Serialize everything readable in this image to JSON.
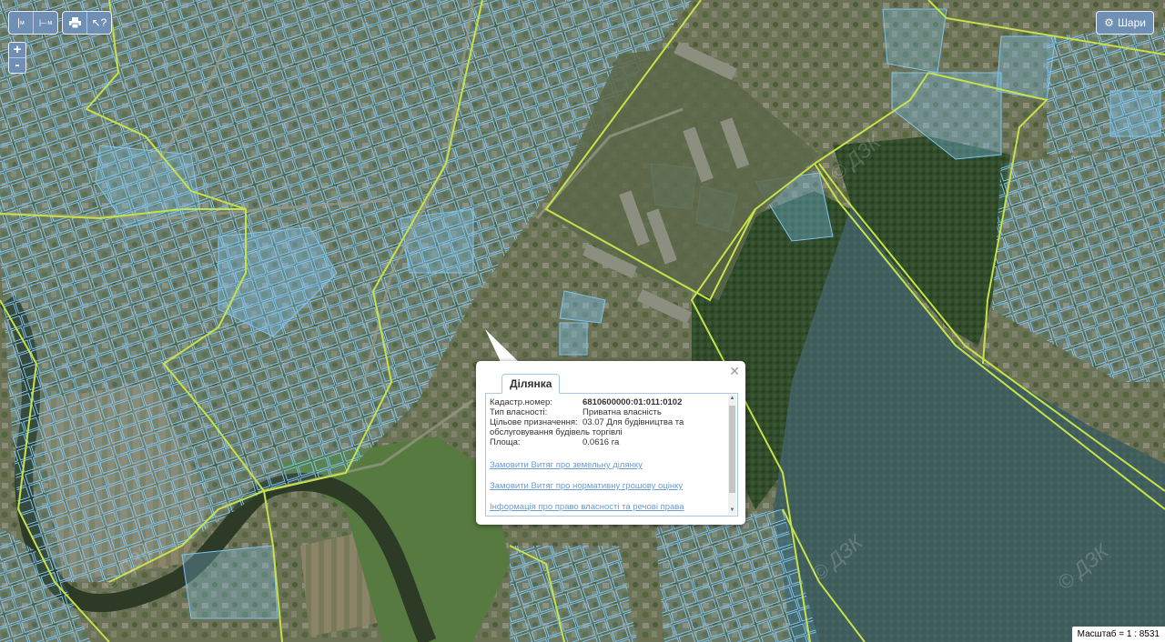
{
  "toolbar": {
    "measure_distance_label": "м",
    "measure_area_label": "м",
    "print_icon": "print-icon",
    "identify_icon": "identify-icon"
  },
  "zoom": {
    "in_label": "+",
    "out_label": "-"
  },
  "layers": {
    "label": "Шари",
    "icon": "gear-icon"
  },
  "popup": {
    "tab_label": "Ділянка",
    "close_label": "✕",
    "fields": [
      {
        "label": "Кадастр.номер:",
        "value": "6810600000:01:011:0102"
      },
      {
        "label": "Тип власності:",
        "value": "Приватна власність"
      },
      {
        "label": "Цільове призначення:",
        "value": "03.07 Для будівництва та обслуговування будівель торгівлі"
      },
      {
        "label": "Площа:",
        "value": "0.0616 га"
      }
    ],
    "links": [
      "Замовити Витяг про земельну ділянку",
      "Замовити Витяг про нормативну грошову оцінку",
      "Інформація про право власності та речові права"
    ]
  },
  "watermark": "© ДЗК",
  "scale": {
    "label": "Масштаб = 1 : 8531"
  },
  "colors": {
    "parcel_outline": "#7ec3f0",
    "boundary": "#c6e24a",
    "forest_overlay": "#6f93b3",
    "control_bg": "#6f8fb5"
  }
}
